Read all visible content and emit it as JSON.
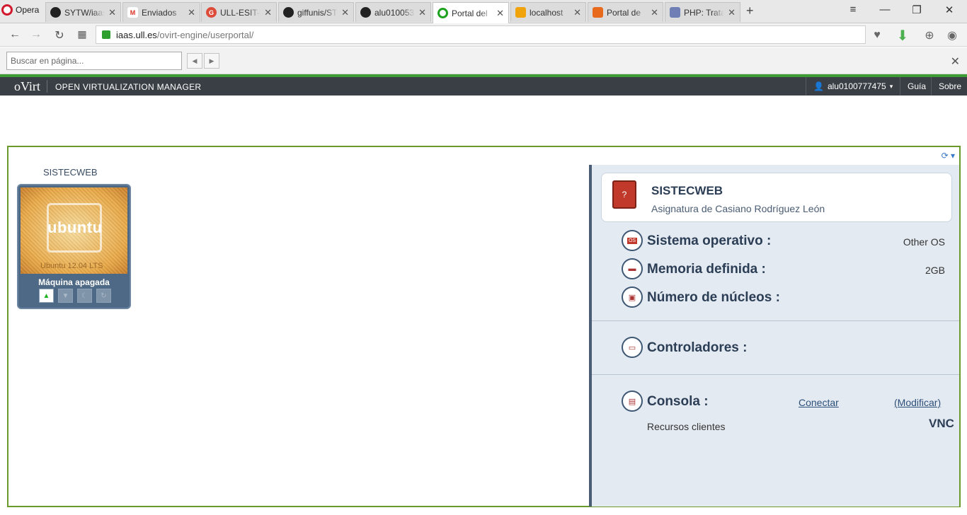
{
  "browser": {
    "opera_label": "Opera",
    "tabs": [
      {
        "title": "SYTW/iaas",
        "favicon": "github-icon"
      },
      {
        "title": "Enviados",
        "favicon": "gmail-icon"
      },
      {
        "title": "ULL-ESIT-S",
        "favicon": "google-plus-icon"
      },
      {
        "title": "giffunis/ST",
        "favicon": "github-icon"
      },
      {
        "title": "alu010053",
        "favicon": "github-icon"
      },
      {
        "title": "Portal del",
        "favicon": "opera-icon"
      },
      {
        "title": "localhost",
        "favicon": "phpmyadmin-icon"
      },
      {
        "title": "Portal de",
        "favicon": "portal-icon"
      },
      {
        "title": "PHP: Trata",
        "favicon": "php-icon"
      }
    ],
    "url_domain": "iaas.ull.es",
    "url_path": "/ovirt-engine/userportal/",
    "find_placeholder": "Buscar en página..."
  },
  "header": {
    "logo": "oVirt",
    "title": "OPEN VIRTUALIZATION MANAGER",
    "user": "alu0100777475",
    "guide": "Guía",
    "about": "Sobre"
  },
  "vm": {
    "name": "SISTECWEB",
    "image_text": "ubuntu",
    "image_version": "Ubuntu 12.04 LTS",
    "status": "Máquina apagada"
  },
  "details": {
    "name": "SISTECWEB",
    "description": "Asignatura de Casiano Rodríguez León",
    "os_badge": "OS",
    "os_label": "Sistema operativo :",
    "os_value": "Other OS",
    "memory_label": "Memoria definida :",
    "memory_value": "2GB",
    "cores_label": "Número de núcleos :",
    "controllers_label": "Controladores :",
    "console_label": "Consola :",
    "connect_link": "Conectar",
    "modify_link": "(Modificar)",
    "client_resources": "Recursos clientes",
    "console_protocol": "VNC"
  },
  "colors": {
    "header_bg": "#393f44",
    "accent_green": "#3f9c35",
    "panel_border": "#6a9a2c",
    "details_bg": "#e4eaf2"
  }
}
